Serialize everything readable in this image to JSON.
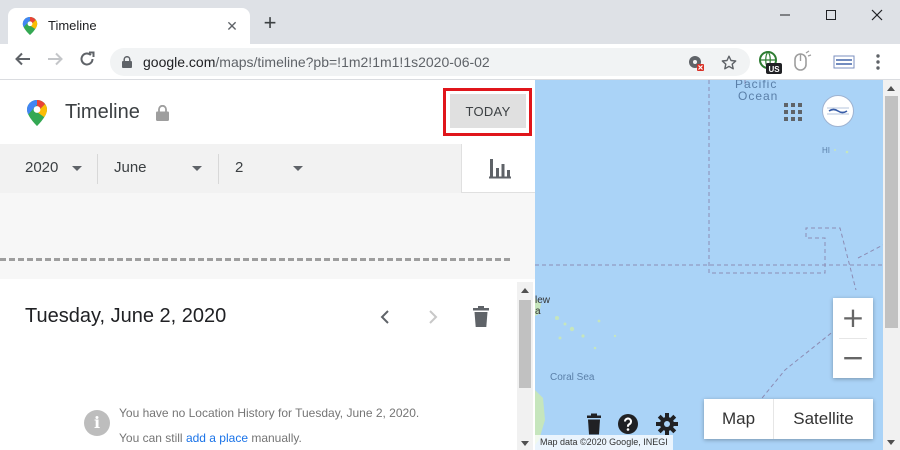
{
  "browser": {
    "tab_title": "Timeline",
    "new_tab": "+",
    "url_host": "google.com",
    "url_path": "/maps/timeline?pb=!1m2!1m1!1s2020-06-02"
  },
  "timeline": {
    "title": "Timeline",
    "today_button": "TODAY",
    "year": "2020",
    "month": "June",
    "day": "2",
    "date_heading": "Tuesday, June 2, 2020",
    "no_history_msg": "You have no Location History for Tuesday, June 2, 2020.",
    "add_prefix": "You can still ",
    "add_link": "add a place",
    "add_suffix": " manually."
  },
  "map": {
    "ocean_label_1": "Pacific",
    "ocean_label_2": "Ocean",
    "hi_label": "HI",
    "new_label_1": "lew",
    "new_label_2": "a",
    "coral_sea": "Coral Sea",
    "zoom_in": "+",
    "zoom_out": "−",
    "map_button": "Map",
    "satellite_button": "Satellite",
    "attribution": "Map data ©2020 Google, INEGI",
    "badge_us": "US"
  },
  "colors": {
    "highlight": "#e0151b",
    "map_water": "#aad3f7",
    "link": "#1a73e8"
  }
}
